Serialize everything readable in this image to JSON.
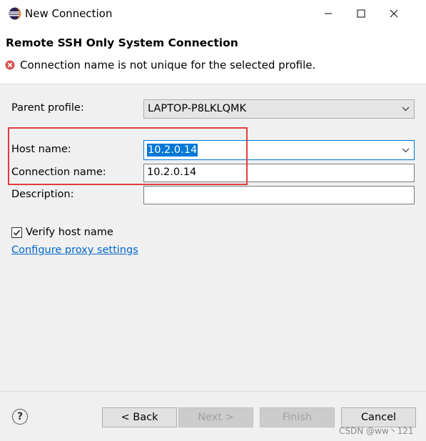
{
  "window": {
    "title": "New Connection",
    "icon": "eclipse-icon",
    "controls": [
      "minimize-icon",
      "maximize-icon",
      "close-icon"
    ]
  },
  "header": {
    "page_title": "Remote SSH Only System Connection",
    "error_icon": "error-icon",
    "error_message": "Connection name is not unique for the selected profile."
  },
  "form": {
    "parent_profile_label": "Parent profile:",
    "parent_profile_value": "LAPTOP-P8LKLQMK",
    "host_name_label": "Host name:",
    "host_name_value": "10.2.0.14",
    "connection_name_label": "Connection name:",
    "connection_name_value": "10.2.0.14",
    "description_label": "Description:",
    "description_value": "",
    "verify_host_label": "Verify host name",
    "verify_host_checked": true,
    "proxy_link": "Configure proxy settings"
  },
  "buttons": {
    "help": "?",
    "back": "< Back",
    "next": "Next >",
    "finish": "Finish",
    "cancel": "Cancel"
  },
  "watermark": "CSDN @ww丶121",
  "colors": {
    "highlight_box": "#e03c3c",
    "selection": "#0078d7",
    "link": "#0066cc"
  }
}
